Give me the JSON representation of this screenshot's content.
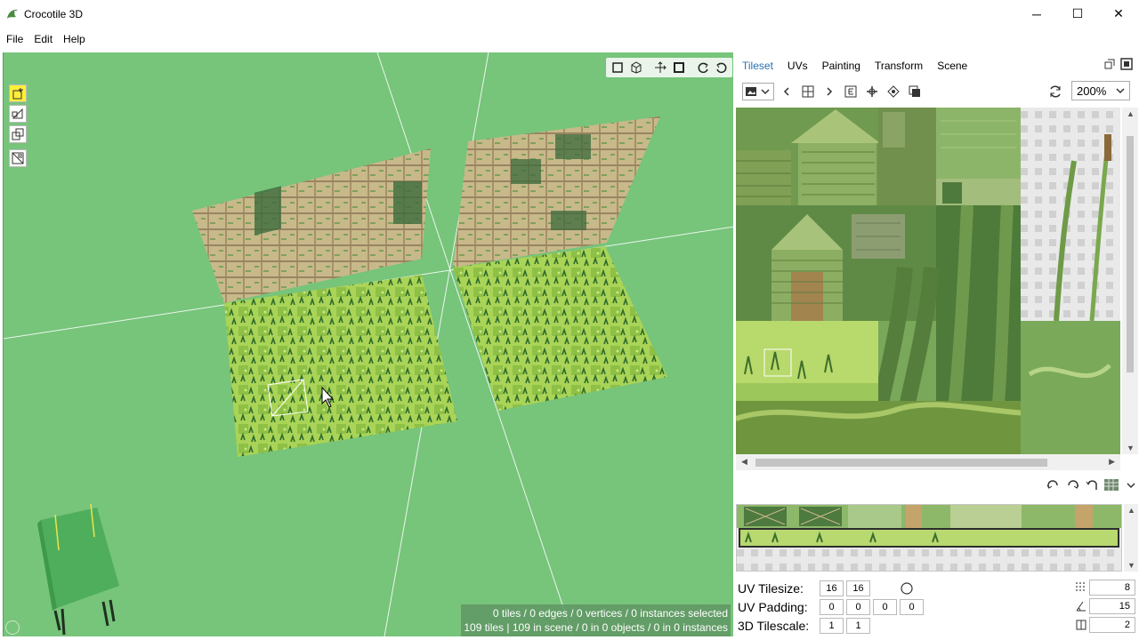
{
  "window": {
    "title": "Crocotile 3D",
    "minimize_glyph": "─",
    "maximize_glyph": "☐",
    "close_glyph": "✕"
  },
  "menu": {
    "items": [
      "File",
      "Edit",
      "Help"
    ]
  },
  "viewport": {
    "status_line1": "0 tiles / 0 edges / 0 vertices / 0 instances selected",
    "status_line2": "109 tiles | 109 in scene / 0 in 0 objects / 0 in 0 instances",
    "background_color": "#77c47b"
  },
  "panel": {
    "tabs": [
      "Tileset",
      "UVs",
      "Painting",
      "Transform",
      "Scene"
    ],
    "active_tab": "Tileset",
    "zoom_value": "200%",
    "uv_tilesize_label": "UV Tilesize:",
    "uv_tilesize": [
      "16",
      "16"
    ],
    "uv_padding_label": "UV Padding:",
    "uv_padding": [
      "0",
      "0",
      "0",
      "0"
    ],
    "tilescale_label": "3D Tilescale:",
    "tilescale": [
      "1",
      "1"
    ],
    "right_values": [
      "8",
      "15",
      "2"
    ]
  },
  "colors": {
    "accent_tab": "#2a6fb5",
    "select_yellow": "#ffee3a",
    "panel_bg": "#ffffff"
  }
}
